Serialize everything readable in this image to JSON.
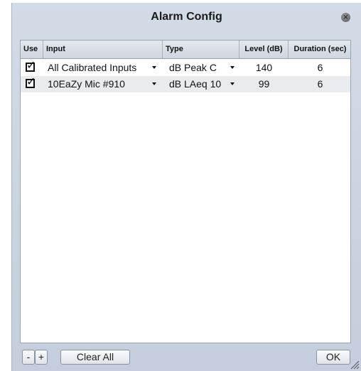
{
  "window": {
    "title": "Alarm Config"
  },
  "table": {
    "headers": {
      "use": "Use",
      "input": "Input",
      "type": "Type",
      "level": "Level (dB)",
      "duration": "Duration (sec)"
    },
    "rows": [
      {
        "use": true,
        "use_mark": "✓",
        "input": "All Calibrated Inputs",
        "type": "dB Peak C",
        "level": "140",
        "duration": "6"
      },
      {
        "use": true,
        "use_mark": "✓",
        "input": "10EaZy Mic #910",
        "type": "dB LAeq 10",
        "level": "99",
        "duration": "6"
      }
    ]
  },
  "footer": {
    "remove_label": "-",
    "add_label": "+",
    "clear_all_label": "Clear All",
    "ok_label": "OK"
  },
  "icons": {
    "close": "close-icon",
    "dropdown": "chevron-down-icon",
    "resize": "resize-grip-icon"
  },
  "colors": {
    "window_bg": "#c9d2df",
    "row_alt": "#e9ecef"
  }
}
